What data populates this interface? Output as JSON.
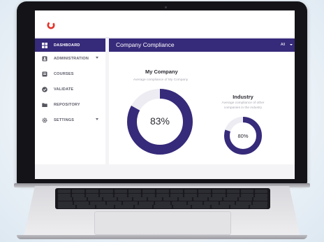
{
  "sidebar": {
    "items": [
      {
        "label": "DASHBOARD",
        "icon": "dashboard-icon",
        "active": true
      },
      {
        "label": "ADMINISTRATION",
        "icon": "user-badge-icon",
        "caret": true
      },
      {
        "label": "COURSES",
        "icon": "courses-icon"
      },
      {
        "label": "VALIDATE",
        "icon": "check-circle-icon"
      },
      {
        "label": "REPOSITORY",
        "icon": "folder-icon"
      },
      {
        "label": "SETTINGS",
        "icon": "gear-icon",
        "caret": true
      }
    ]
  },
  "main": {
    "title": "Company Compliance",
    "filter": "All",
    "my_company": {
      "title": "My Company",
      "subtitle": "Average compliance of My Company",
      "percent_label": "83%",
      "fraction": 0.83
    },
    "industry": {
      "title": "Industry",
      "subtitle": "Average compliance of other companies in the industry",
      "percent_label": "80%",
      "fraction": 0.8
    }
  },
  "colors": {
    "accent": "#362a7a",
    "donut_track": "#ececf2",
    "logo_red": "#e5332a"
  }
}
